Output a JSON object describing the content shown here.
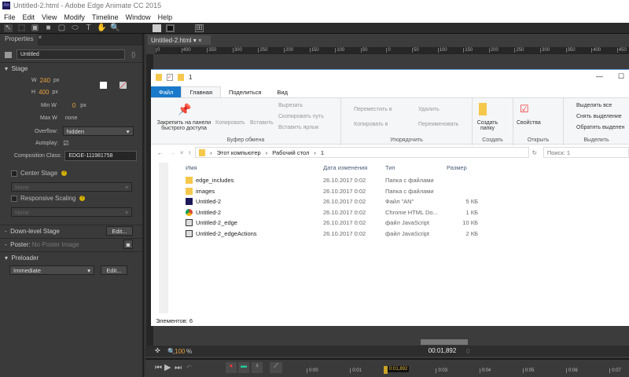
{
  "window": {
    "title": "Untitled-2.html - Adobe Edge Animate CC 2015",
    "logo": "An"
  },
  "menu": [
    "File",
    "Edit",
    "View",
    "Modify",
    "Timeline",
    "Window",
    "Help"
  ],
  "properties": {
    "tab": "Properties",
    "element_name": "Untitled",
    "section_stage": "Stage",
    "w_label": "W",
    "w_value": "240",
    "h_label": "H",
    "h_value": "400",
    "unit": "px",
    "minw_label": "Min W",
    "minw_value": "0",
    "maxw_label": "Max W",
    "maxw_value": "none",
    "overflow_label": "Overflow:",
    "overflow_value": "hidden",
    "autoplay_label": "Autoplay:",
    "autoplay_checked": true,
    "compclass_label": "Composition Class:",
    "compclass_value": "EDGE-111981758",
    "center_stage": "Center Stage",
    "center_none": "None",
    "responsive": "Responsive Scaling",
    "responsive_none": "None",
    "downlevel": "Down-level Stage",
    "edit": "Edit...",
    "poster_label": "Poster:",
    "poster_value": "No Poster Image",
    "preloader": "Preloader",
    "preloader_value": "Immediate",
    "stage_color": "#ffffff"
  },
  "doc_tab": "Untitled-2.html",
  "ruler": [
    "0",
    "400",
    "350",
    "300",
    "250",
    "200",
    "150",
    "100",
    "50",
    "0",
    "50",
    "100",
    "150",
    "200",
    "250",
    "300",
    "350",
    "400",
    "450"
  ],
  "explorer": {
    "path_title": "1",
    "tabs": [
      "Файл",
      "Главная",
      "Поделиться",
      "Вид"
    ],
    "ribbon": {
      "pin": "Закрепить на панели быстрого доступа",
      "copy": "Копировать",
      "paste": "Вставить",
      "cut": "Вырезать",
      "copy_path": "Скопировать путь",
      "paste_shortcut": "Вставить ярлык",
      "clipboard": "Буфер обмена",
      "move_to": "Переместить в",
      "copy_to": "Копировать в",
      "delete": "Удалить",
      "rename": "Переименовать",
      "organize": "Упорядочить",
      "new_folder": "Создать папку",
      "create": "Создать",
      "properties": "Свойства",
      "open": "Открыть",
      "select_all": "Выделить все",
      "select_none": "Снять выделение",
      "invert": "Обратить выделен",
      "select": "Выделить"
    },
    "address": [
      "Этот компьютер",
      "Рабочий стол",
      "1"
    ],
    "search_placeholder": "Поиск: 1",
    "columns": [
      "Имя",
      "Дата изменения",
      "Тип",
      "Размер"
    ],
    "files": [
      {
        "name": "edge_includes",
        "date": "26.10.2017 0:02",
        "type": "Папка с файлами",
        "size": "",
        "icon": "folder-icon"
      },
      {
        "name": "images",
        "date": "26.10.2017 0:02",
        "type": "Папка с файлами",
        "size": "",
        "icon": "folder-icon"
      },
      {
        "name": "Untitled-2",
        "date": "26.10.2017 0:02",
        "type": "Файл \"AN\"",
        "size": "5 КБ",
        "icon": "an-file-icon"
      },
      {
        "name": "Untitled-2",
        "date": "26.10.2017 0:02",
        "type": "Chrome HTML Do...",
        "size": "1 КБ",
        "icon": "chrome-icon"
      },
      {
        "name": "Untitled-2_edge",
        "date": "26.10.2017 0:02",
        "type": "файл JavaScript",
        "size": "10 КБ",
        "icon": "js-file-icon"
      },
      {
        "name": "Untitled-2_edgeActions",
        "date": "26.10.2017 0:02",
        "type": "файл JavaScript",
        "size": "2 КБ",
        "icon": "js-file-icon"
      }
    ],
    "status": "Элементов: 6"
  },
  "zoom": {
    "value": "100",
    "unit": "%"
  },
  "time": {
    "current": "00:01,892",
    "frame": "0",
    "playhead": "0:01,892",
    "ticks": [
      "0:00",
      "0:01",
      "0:03",
      "0:04",
      "0:05",
      "0:06",
      "0:07"
    ]
  }
}
